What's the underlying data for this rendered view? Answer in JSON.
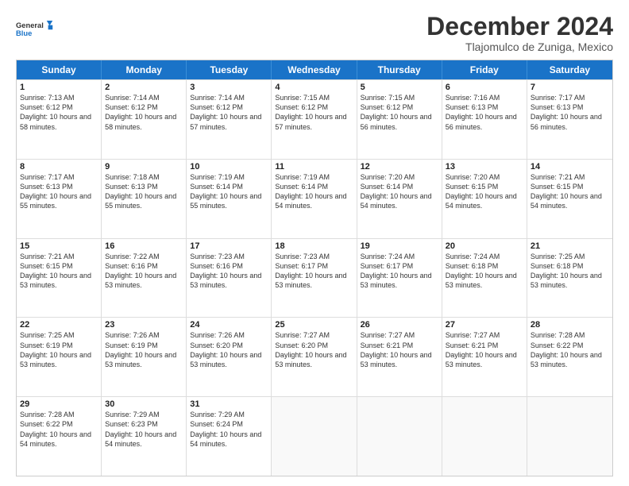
{
  "logo": {
    "line1": "General",
    "line2": "Blue"
  },
  "title": "December 2024",
  "subtitle": "Tlajomulco de Zuniga, Mexico",
  "header_days": [
    "Sunday",
    "Monday",
    "Tuesday",
    "Wednesday",
    "Thursday",
    "Friday",
    "Saturday"
  ],
  "weeks": [
    [
      {
        "day": "1",
        "rise": "7:13 AM",
        "set": "6:12 PM",
        "daylight": "10 hours and 58 minutes."
      },
      {
        "day": "2",
        "rise": "7:14 AM",
        "set": "6:12 PM",
        "daylight": "10 hours and 58 minutes."
      },
      {
        "day": "3",
        "rise": "7:14 AM",
        "set": "6:12 PM",
        "daylight": "10 hours and 57 minutes."
      },
      {
        "day": "4",
        "rise": "7:15 AM",
        "set": "6:12 PM",
        "daylight": "10 hours and 57 minutes."
      },
      {
        "day": "5",
        "rise": "7:15 AM",
        "set": "6:12 PM",
        "daylight": "10 hours and 56 minutes."
      },
      {
        "day": "6",
        "rise": "7:16 AM",
        "set": "6:13 PM",
        "daylight": "10 hours and 56 minutes."
      },
      {
        "day": "7",
        "rise": "7:17 AM",
        "set": "6:13 PM",
        "daylight": "10 hours and 56 minutes."
      }
    ],
    [
      {
        "day": "8",
        "rise": "7:17 AM",
        "set": "6:13 PM",
        "daylight": "10 hours and 55 minutes."
      },
      {
        "day": "9",
        "rise": "7:18 AM",
        "set": "6:13 PM",
        "daylight": "10 hours and 55 minutes."
      },
      {
        "day": "10",
        "rise": "7:19 AM",
        "set": "6:14 PM",
        "daylight": "10 hours and 55 minutes."
      },
      {
        "day": "11",
        "rise": "7:19 AM",
        "set": "6:14 PM",
        "daylight": "10 hours and 54 minutes."
      },
      {
        "day": "12",
        "rise": "7:20 AM",
        "set": "6:14 PM",
        "daylight": "10 hours and 54 minutes."
      },
      {
        "day": "13",
        "rise": "7:20 AM",
        "set": "6:15 PM",
        "daylight": "10 hours and 54 minutes."
      },
      {
        "day": "14",
        "rise": "7:21 AM",
        "set": "6:15 PM",
        "daylight": "10 hours and 54 minutes."
      }
    ],
    [
      {
        "day": "15",
        "rise": "7:21 AM",
        "set": "6:15 PM",
        "daylight": "10 hours and 53 minutes."
      },
      {
        "day": "16",
        "rise": "7:22 AM",
        "set": "6:16 PM",
        "daylight": "10 hours and 53 minutes."
      },
      {
        "day": "17",
        "rise": "7:23 AM",
        "set": "6:16 PM",
        "daylight": "10 hours and 53 minutes."
      },
      {
        "day": "18",
        "rise": "7:23 AM",
        "set": "6:17 PM",
        "daylight": "10 hours and 53 minutes."
      },
      {
        "day": "19",
        "rise": "7:24 AM",
        "set": "6:17 PM",
        "daylight": "10 hours and 53 minutes."
      },
      {
        "day": "20",
        "rise": "7:24 AM",
        "set": "6:18 PM",
        "daylight": "10 hours and 53 minutes."
      },
      {
        "day": "21",
        "rise": "7:25 AM",
        "set": "6:18 PM",
        "daylight": "10 hours and 53 minutes."
      }
    ],
    [
      {
        "day": "22",
        "rise": "7:25 AM",
        "set": "6:19 PM",
        "daylight": "10 hours and 53 minutes."
      },
      {
        "day": "23",
        "rise": "7:26 AM",
        "set": "6:19 PM",
        "daylight": "10 hours and 53 minutes."
      },
      {
        "day": "24",
        "rise": "7:26 AM",
        "set": "6:20 PM",
        "daylight": "10 hours and 53 minutes."
      },
      {
        "day": "25",
        "rise": "7:27 AM",
        "set": "6:20 PM",
        "daylight": "10 hours and 53 minutes."
      },
      {
        "day": "26",
        "rise": "7:27 AM",
        "set": "6:21 PM",
        "daylight": "10 hours and 53 minutes."
      },
      {
        "day": "27",
        "rise": "7:27 AM",
        "set": "6:21 PM",
        "daylight": "10 hours and 53 minutes."
      },
      {
        "day": "28",
        "rise": "7:28 AM",
        "set": "6:22 PM",
        "daylight": "10 hours and 53 minutes."
      }
    ],
    [
      {
        "day": "29",
        "rise": "7:28 AM",
        "set": "6:22 PM",
        "daylight": "10 hours and 54 minutes."
      },
      {
        "day": "30",
        "rise": "7:29 AM",
        "set": "6:23 PM",
        "daylight": "10 hours and 54 minutes."
      },
      {
        "day": "31",
        "rise": "7:29 AM",
        "set": "6:24 PM",
        "daylight": "10 hours and 54 minutes."
      },
      null,
      null,
      null,
      null
    ]
  ]
}
